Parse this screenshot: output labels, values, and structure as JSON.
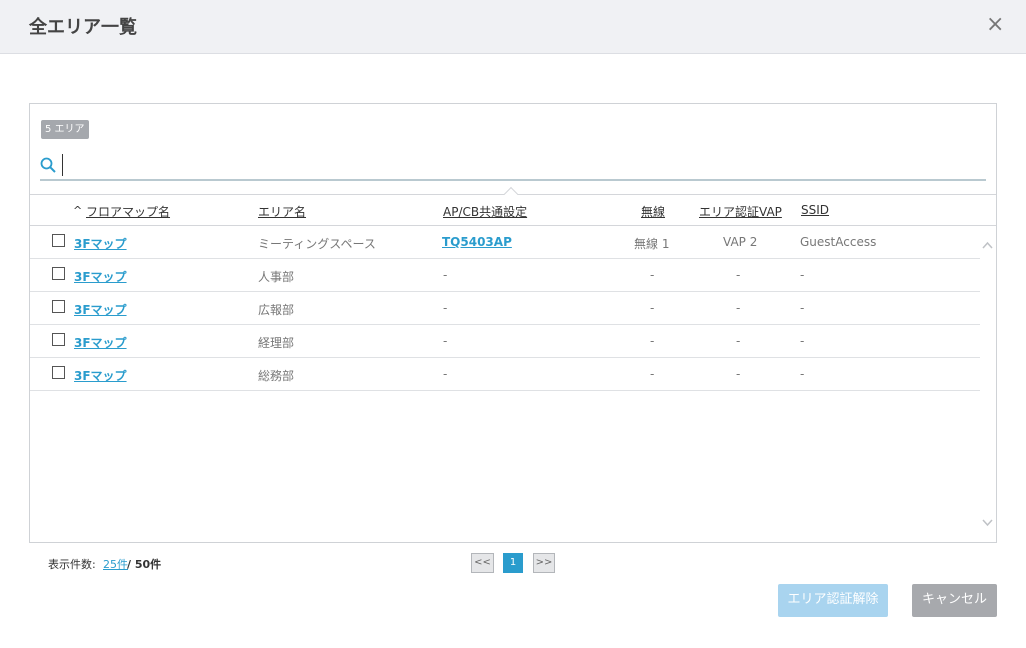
{
  "header": {
    "title": "全エリア一覧",
    "close": "×"
  },
  "panel": {
    "count_badge": "5 エリア",
    "search": {
      "value": "",
      "placeholder": ""
    }
  },
  "table": {
    "sort_arrow": "^",
    "columns": {
      "floor_map": "フロアマップ名",
      "area": "エリア名",
      "ap_cb": "AP/CB共通設定",
      "wireless": "無線",
      "vap": "エリア認証VAP",
      "ssid": "SSID"
    },
    "rows": [
      {
        "floor_map": "3Fマップ",
        "area": "ミーティングスペース",
        "ap_cb": "TQ5403AP",
        "wireless": "無線 1",
        "vap": "VAP 2",
        "ssid": "GuestAccess"
      },
      {
        "floor_map": "3Fマップ",
        "area": "人事部",
        "ap_cb": "-",
        "wireless": "-",
        "vap": "-",
        "ssid": "-"
      },
      {
        "floor_map": "3Fマップ",
        "area": "広報部",
        "ap_cb": "-",
        "wireless": "-",
        "vap": "-",
        "ssid": "-"
      },
      {
        "floor_map": "3Fマップ",
        "area": "経理部",
        "ap_cb": "-",
        "wireless": "-",
        "vap": "-",
        "ssid": "-"
      },
      {
        "floor_map": "3Fマップ",
        "area": "総務部",
        "ap_cb": "-",
        "wireless": "-",
        "vap": "-",
        "ssid": "-"
      }
    ]
  },
  "footer": {
    "display_label": "表示件数:",
    "per_page": "25件",
    "total": "/ 50件",
    "pagination": {
      "prev": "<<",
      "current": "1",
      "next": ">>"
    }
  },
  "buttons": {
    "release": "エリア認証解除",
    "cancel": "キャンセル"
  },
  "icons": {
    "search": "search-icon",
    "close": "close-icon",
    "scroll_up": "chevron-up-icon",
    "scroll_down": "chevron-down-icon"
  },
  "colors": {
    "accent": "#2a9ccd",
    "release_button": "#a9d4ef",
    "cancel_button": "#a7a9ad"
  }
}
